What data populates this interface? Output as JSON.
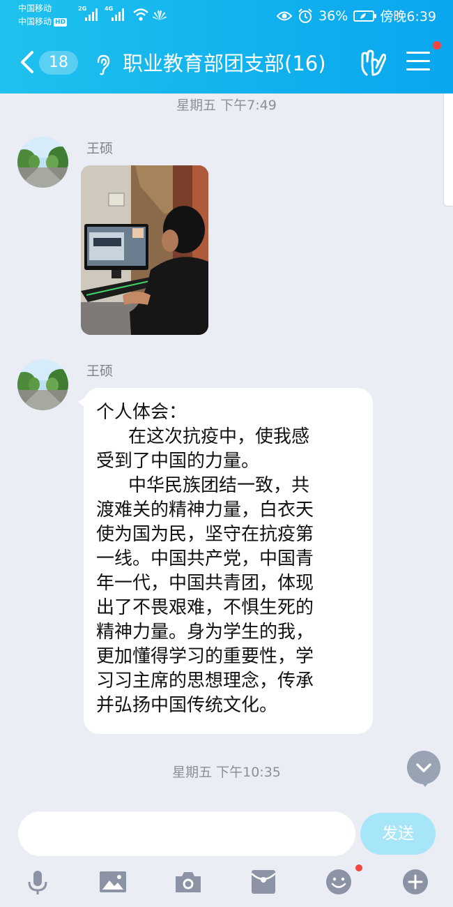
{
  "status_bar": {
    "carrier_1": "中国移动",
    "carrier_2": "中国移动",
    "hd_badge": "HD",
    "net_1": "2G",
    "net_2": "4G",
    "battery_percent": "36%",
    "time": "傍晚6:39"
  },
  "header": {
    "unread_count": "18",
    "title": "职业教育部团支部(16)"
  },
  "chat": {
    "messages": [
      {
        "timestamp": "星期五 下午7:49",
        "sender": "王硕",
        "type": "image"
      },
      {
        "sender": "王硕",
        "type": "text",
        "lines": [
          "个人体会：",
          "在这次抗疫中，使我感",
          "受到了中国的力量。",
          "中华民族团结一致，共",
          "渡难关的精神力量，白衣天",
          "使为国为民，坚守在抗疫第",
          "一线。中国共产党，中国青",
          "年一代，中国共青团，体现",
          "出了不畏艰难，不惧生死的",
          "精神力量。身为学生的我，",
          "更加懂得学习的重要性，学",
          "习习主席的思想理念，传承",
          "并弘扬中国传统文化。"
        ]
      }
    ],
    "last_timestamp": "星期五 下午10:35"
  },
  "input": {
    "value": "",
    "send_label": "发送"
  },
  "toolbar": {
    "icons": [
      "microphone-icon",
      "image-icon",
      "camera-icon",
      "red-packet-icon",
      "emoji-icon",
      "plus-icon"
    ]
  },
  "colors": {
    "header_gradient_start": "#1fc1ee",
    "header_gradient_end": "#0aa6ee",
    "chat_background": "#ebedf5",
    "send_button": "#a7e6f8",
    "notification_dot": "#f5473d",
    "toolbar_icon": "#8c93a5"
  }
}
